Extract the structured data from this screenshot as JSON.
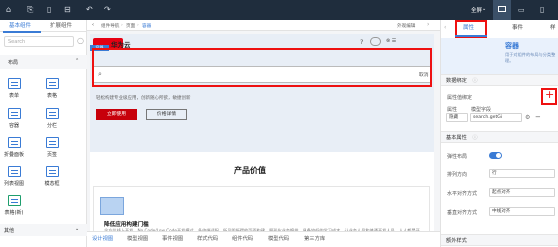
{
  "toolbar": {
    "fullscreen_label": "全屏",
    "icons": [
      "lock-icon",
      "save-icon",
      "layout-icon",
      "undo-icon",
      "redo-icon"
    ]
  },
  "left_panel": {
    "tabs": [
      "基本组件",
      "扩展组件"
    ],
    "search_placeholder": "Search",
    "section_title": "布局",
    "components": [
      {
        "label": "表单",
        "icon": "form-icon"
      },
      {
        "label": "表格",
        "icon": "table-icon"
      },
      {
        "label": "容器",
        "icon": "container-icon"
      },
      {
        "label": "分栏",
        "icon": "columns-icon"
      },
      {
        "label": "折叠面板",
        "icon": "collapse-icon"
      },
      {
        "label": "页签",
        "icon": "tabs-icon"
      },
      {
        "label": "列表视图",
        "icon": "list-icon"
      },
      {
        "label": "模态框",
        "icon": "modal-icon"
      },
      {
        "label": "表格(新)",
        "icon": "table-new-icon"
      }
    ],
    "footer_section": "其他"
  },
  "canvas": {
    "breadcrumb": [
      "组件导航",
      "页面",
      "容器"
    ],
    "extra_link": "外观编辑",
    "brand": "华为云",
    "selected_tag": "容器",
    "search_hint": "",
    "cancel_label": "取消",
    "hero_desc": "轻松构建专业级应用，创新随心所欲，敏捷创新",
    "primary_button": "立即使用",
    "secondary_button": "价格详情",
    "section_title": "产品价值",
    "card_title": "降低应用构建门槛",
    "card_desc": "全方位线上开发，No Code/Low Code开发模式，多终端适配，所见即所得的页面构建，图形化业务编排，具备较低的学习成本，让业务人员和普通开发人员，人人都是开发者",
    "bottom_tabs": [
      "设计视图",
      "模型视图",
      "事件视图",
      "样式代码",
      "组件代码",
      "模型代码",
      "第三方库"
    ]
  },
  "right_panel": {
    "tabs": [
      "属性",
      "事件",
      "样"
    ],
    "component_title": "容器",
    "component_desc": "用于对组件的布局与分类整理。",
    "data_binding": "数据绑定",
    "prop_binding": "属性值绑定",
    "col_attr": "属性",
    "col_model": "模型字段",
    "row_attr": "隐藏",
    "row_model": "search.getGi",
    "basic_props": "基本属性",
    "flex_label": "弹性布局",
    "flex_on": true,
    "direction_label": "排列方向",
    "direction_value": "行",
    "h_align_label": "水平对齐方式",
    "h_align_value": "起点对齐",
    "v_align_label": "垂直对齐方式",
    "v_align_value": "中线对齐",
    "footer_section": "额外样式"
  },
  "colors": {
    "accent": "#e60012",
    "primary": "#3a7bd5",
    "toolbar": "#1f2d3d"
  }
}
